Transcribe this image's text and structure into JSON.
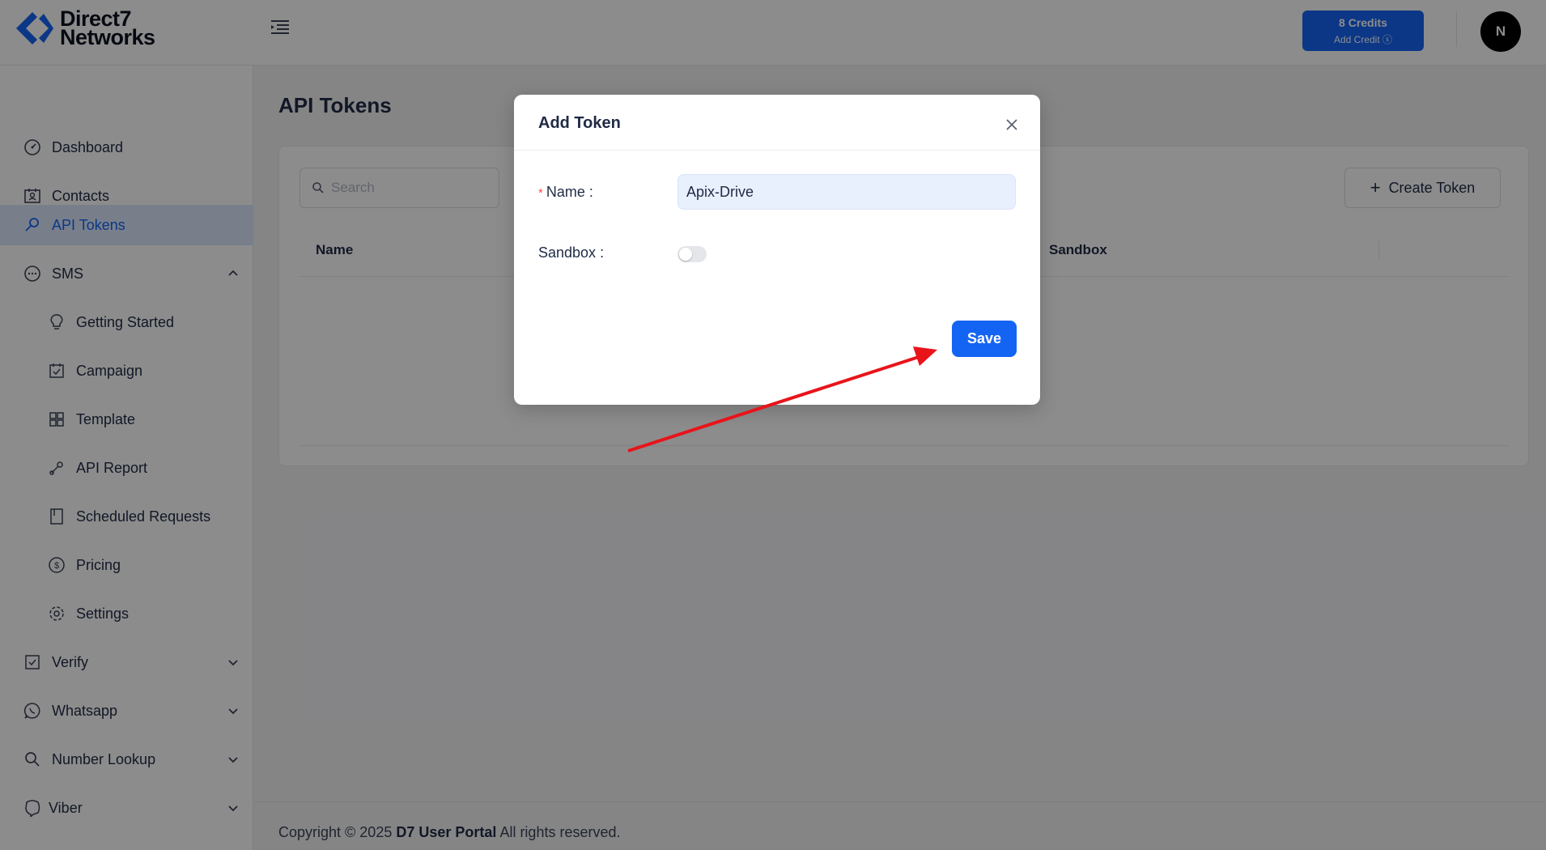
{
  "header": {
    "logo_line1": "Direct7",
    "logo_line2": "Networks",
    "credits": "8 Credits",
    "add_credit": "Add Credit",
    "avatar_initial": "N"
  },
  "sidebar": {
    "items": [
      {
        "label": "Dashboard",
        "icon": "dashboard-icon"
      },
      {
        "label": "Contacts",
        "icon": "contacts-icon"
      },
      {
        "label": "API Tokens",
        "icon": "key-icon"
      },
      {
        "label": "SMS",
        "icon": "sms-icon"
      },
      {
        "label": "Getting Started",
        "icon": "bulb-icon"
      },
      {
        "label": "Campaign",
        "icon": "campaign-icon"
      },
      {
        "label": "Template",
        "icon": "template-icon"
      },
      {
        "label": "API Report",
        "icon": "api-report-icon"
      },
      {
        "label": "Scheduled Requests",
        "icon": "scheduled-icon"
      },
      {
        "label": "Pricing",
        "icon": "pricing-icon"
      },
      {
        "label": "Settings",
        "icon": "gear-icon"
      },
      {
        "label": "Verify",
        "icon": "verify-icon"
      },
      {
        "label": "Whatsapp",
        "icon": "whatsapp-icon"
      },
      {
        "label": "Number Lookup",
        "icon": "search-icon"
      },
      {
        "label": "Viber",
        "icon": "viber-icon"
      }
    ]
  },
  "main": {
    "page_title": "API Tokens",
    "search_placeholder": "Search",
    "create_button": "Create Token",
    "columns": [
      "Name",
      "Sandbox"
    ]
  },
  "footer": {
    "prefix": "Copyright © 2025",
    "brand": "D7 User Portal",
    "suffix": "All rights reserved."
  },
  "modal": {
    "title": "Add Token",
    "name_label": "Name",
    "name_value": "Apix-Drive",
    "sandbox_label": "Sandbox",
    "sandbox_enabled": false,
    "save_label": "Save"
  },
  "colors": {
    "accent": "#1464f4",
    "active_bg": "#dbe7fe",
    "annotation_arrow": "#e8141a"
  }
}
